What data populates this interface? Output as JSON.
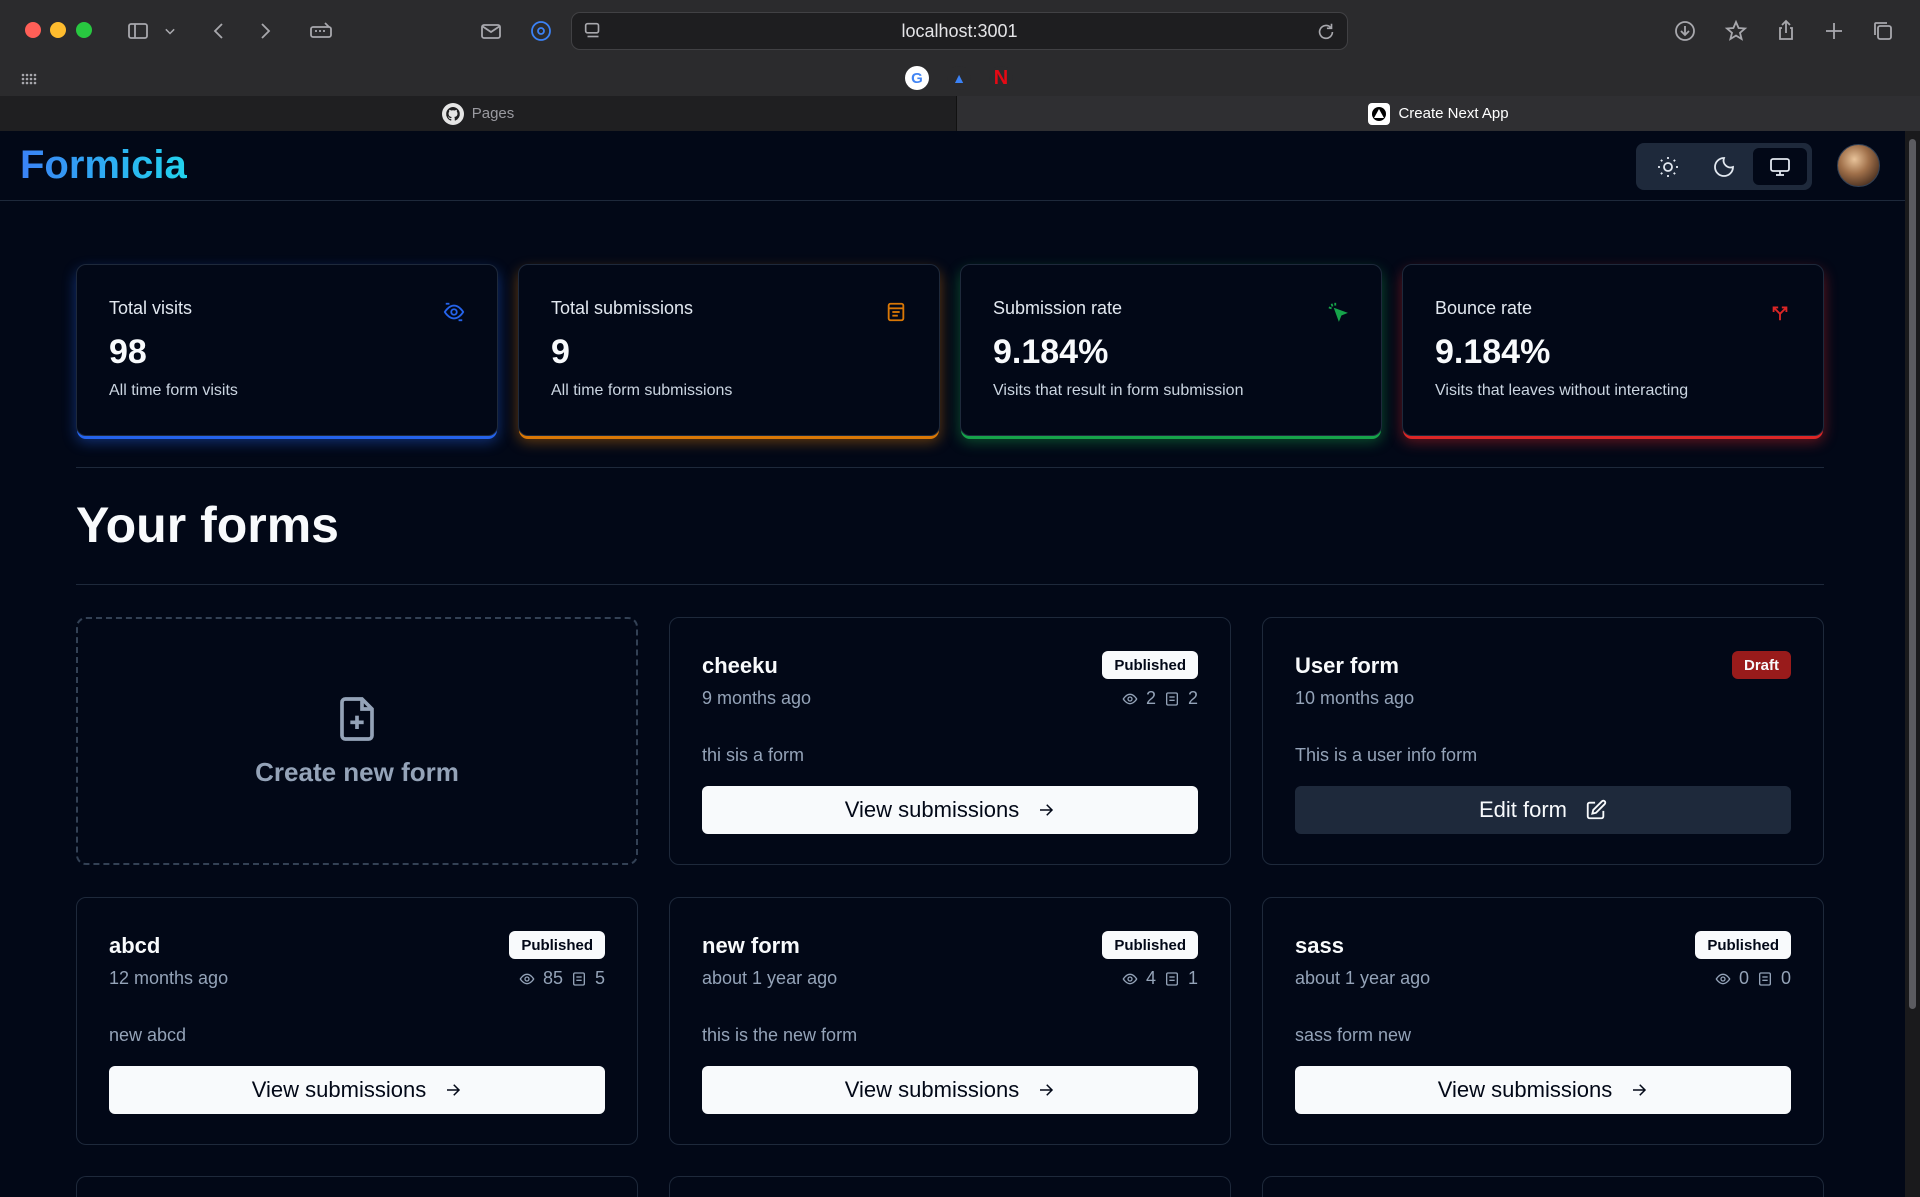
{
  "browser": {
    "url": "localhost:3001",
    "tabs": [
      {
        "label": "Pages",
        "icon": "github-icon"
      },
      {
        "label": "Create Next App",
        "icon": "nextjs-icon"
      }
    ],
    "favorites": [
      {
        "name": "google-favicon",
        "letter": "G"
      },
      {
        "name": "drive-favicon",
        "letter": "▲"
      },
      {
        "name": "netflix-favicon",
        "letter": "N"
      }
    ]
  },
  "header": {
    "logo": "Formicia",
    "theme_options": [
      "light",
      "dark",
      "system"
    ],
    "active_theme": "system"
  },
  "stats": [
    {
      "title": "Total visits",
      "value": "98",
      "help": "All time form visits",
      "icon": "eye-icon",
      "color": "#2563eb"
    },
    {
      "title": "Total submissions",
      "value": "9",
      "help": "All time form submissions",
      "icon": "form-icon",
      "color": "#d97706"
    },
    {
      "title": "Submission rate",
      "value": "9.184%",
      "help": "Visits that result in form submission",
      "icon": "cursor-click-icon",
      "color": "#16a34a"
    },
    {
      "title": "Bounce rate",
      "value": "9.184%",
      "help": "Visits that leaves without interacting",
      "icon": "split-arrow-icon",
      "color": "#dc2626"
    }
  ],
  "forms_section": {
    "title": "Your forms",
    "create_label": "Create new form"
  },
  "forms": [
    {
      "name": "cheeku",
      "status": "Published",
      "time": "9 months ago",
      "visits": "2",
      "submissions": "2",
      "description": "thi sis a form",
      "action": "View submissions"
    },
    {
      "name": "User form",
      "status": "Draft",
      "time": "10 months ago",
      "visits": "",
      "submissions": "",
      "description": "This is a user info form",
      "action": "Edit form"
    },
    {
      "name": "abcd",
      "status": "Published",
      "time": "12 months ago",
      "visits": "85",
      "submissions": "5",
      "description": "new abcd",
      "action": "View submissions"
    },
    {
      "name": "new form",
      "status": "Published",
      "time": "about 1 year ago",
      "visits": "4",
      "submissions": "1",
      "description": "this is the new form",
      "action": "View submissions"
    },
    {
      "name": "sass",
      "status": "Published",
      "time": "about 1 year ago",
      "visits": "0",
      "submissions": "0",
      "description": "sass form new",
      "action": "View submissions"
    }
  ]
}
